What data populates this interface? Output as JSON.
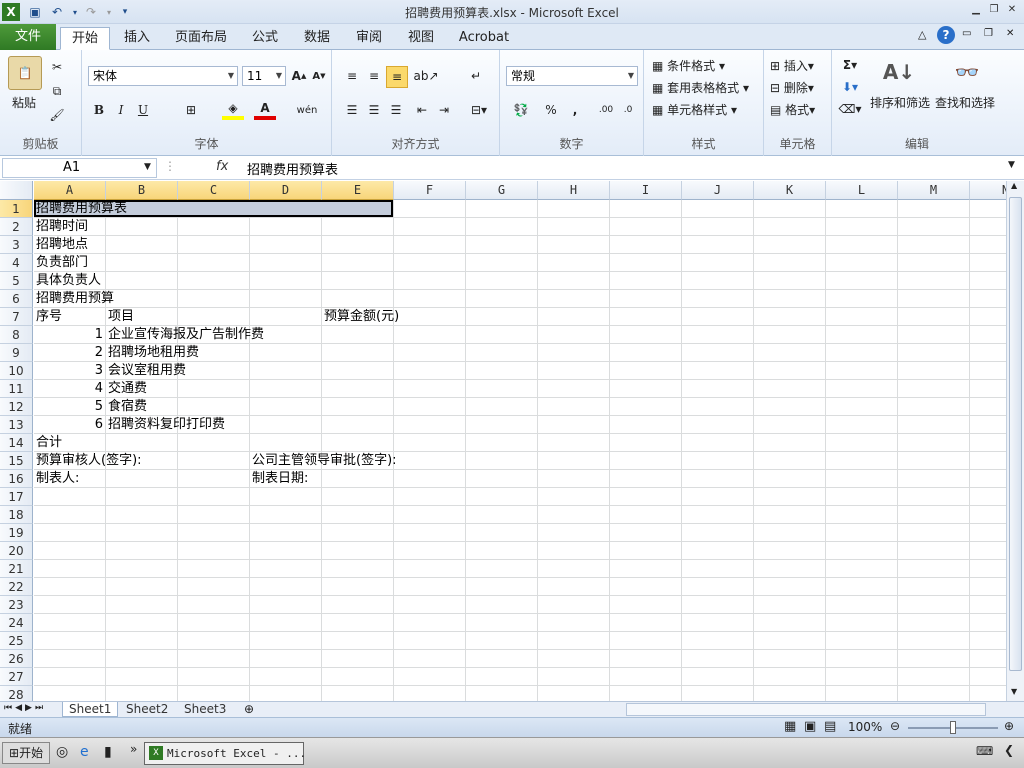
{
  "titlebar": {
    "title": "招聘费用预算表.xlsx - Microsoft Excel"
  },
  "tabs": [
    "文件",
    "开始",
    "插入",
    "页面布局",
    "公式",
    "数据",
    "审阅",
    "视图",
    "Acrobat"
  ],
  "ribbon": {
    "clipboard": {
      "label": "剪贴板",
      "paste": "粘贴"
    },
    "font": {
      "label": "字体",
      "name": "宋体",
      "size": "11"
    },
    "alignment": {
      "label": "对齐方式"
    },
    "number": {
      "label": "数字",
      "format": "常规"
    },
    "styles": {
      "label": "样式",
      "cond": "条件格式",
      "table": "套用表格格式",
      "cell": "单元格样式"
    },
    "cells": {
      "label": "单元格",
      "insert": "插入",
      "delete": "删除",
      "format": "格式"
    },
    "editing": {
      "label": "编辑",
      "sort": "排序和筛选",
      "find": "查找和选择"
    }
  },
  "formula_bar": {
    "namebox": "A1",
    "fx": "fx",
    "content": "招聘费用预算表"
  },
  "columns": [
    "A",
    "B",
    "C",
    "D",
    "E",
    "F",
    "G",
    "H",
    "I",
    "J",
    "K",
    "L",
    "M",
    "N"
  ],
  "rows": [
    "1",
    "2",
    "3",
    "4",
    "5",
    "6",
    "7",
    "8",
    "9",
    "10",
    "11",
    "12",
    "13",
    "14",
    "15",
    "16",
    "17",
    "18",
    "19",
    "20",
    "21",
    "22",
    "23",
    "24",
    "25",
    "26",
    "27",
    "28"
  ],
  "cells": {
    "A1": "招聘费用预算表",
    "A2": "招聘时间",
    "A3": "招聘地点",
    "A4": "负责部门",
    "A5": "具体负责人",
    "A6": "招聘费用预算",
    "A7": "序号",
    "B7": "项目",
    "E7": "预算金额(元)",
    "A8": "1",
    "B8": "企业宣传海报及广告制作费",
    "A9": "2",
    "B9": "招聘场地租用费",
    "A10": "3",
    "B10": "会议室租用费",
    "A11": "4",
    "B11": "交通费",
    "A12": "5",
    "B12": "食宿费",
    "A13": "6",
    "B13": "招聘资料复印打印费",
    "A14": "合计",
    "A15": "预算审核人(签字):",
    "D15": "公司主管领导审批(签字):",
    "A16": "制表人:",
    "D16": "制表日期:"
  },
  "sheets": [
    "Sheet1",
    "Sheet2",
    "Sheet3"
  ],
  "status": {
    "ready": "就绪",
    "zoom": "100%"
  },
  "taskbar": {
    "start": "开始",
    "app": "Microsoft Excel - ..."
  }
}
